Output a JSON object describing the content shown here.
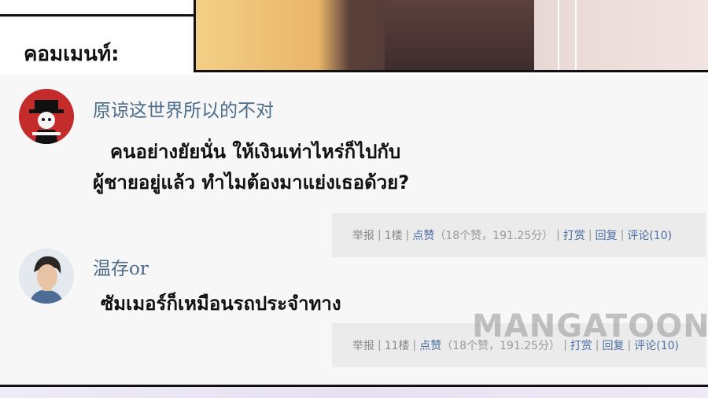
{
  "heading": "คอมเมนท์:",
  "comments": [
    {
      "username": "原谅这世界所以的不对",
      "lines": [
        "คนอย่างยัยนั่น ให้เงินเท่าไหร่ก็ไปกับ",
        "ผู้ชายอยู่แล้ว ทำไมต้องมาแย่งเธอด้วย?"
      ],
      "actions": {
        "report": "举报",
        "floor": "1楼",
        "like": "点赞",
        "like_stats": "（18个赞，191.25分）",
        "reward": "打赏",
        "reply": "回复",
        "comment": "评论(10)"
      }
    },
    {
      "username": "温存or",
      "lines": [
        "ซัมเมอร์ก็เหมือนรถประจำทาง"
      ],
      "actions": {
        "report": "举报",
        "floor": "11楼",
        "like": "点赞",
        "like_stats": "（18个赞，191.25分）",
        "reward": "打赏",
        "reply": "回复",
        "comment": "评论(10)"
      }
    }
  ],
  "watermark": "MANGATOON",
  "colors": {
    "username": "#4a6b8a",
    "action_link": "#4a6fa5",
    "action_bar": "#ebebeb"
  }
}
